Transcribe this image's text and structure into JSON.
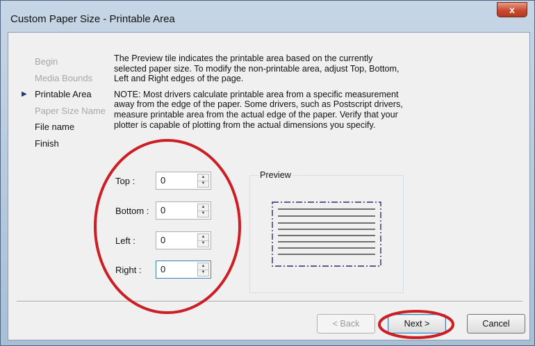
{
  "window": {
    "title": "Custom Paper Size - Printable Area",
    "close_label": "x"
  },
  "steps": [
    {
      "label": "Begin",
      "state": "done-dim"
    },
    {
      "label": "Media Bounds",
      "state": "done-dim"
    },
    {
      "label": "Printable Area",
      "state": "current"
    },
    {
      "label": "Paper Size Name",
      "state": "done-dim"
    },
    {
      "label": "File name",
      "state": "pending"
    },
    {
      "label": "Finish",
      "state": "pending"
    }
  ],
  "description": {
    "intro": "The Preview tile indicates the printable area based on the currently selected paper size. To modify the non-printable area, adjust Top, Bottom, Left and Right edges of the page.",
    "note": "NOTE: Most drivers calculate printable area from a specific measurement away from the edge of the paper. Some drivers, such as Postscript drivers, measure printable area from the actual edge of the paper. Verify that your plotter is capable of plotting from the actual dimensions you specify."
  },
  "fields": {
    "top": {
      "label": "Top :",
      "value": "0"
    },
    "bottom": {
      "label": "Bottom :",
      "value": "0"
    },
    "left": {
      "label": "Left :",
      "value": "0"
    },
    "right": {
      "label": "Right :",
      "value": "0"
    }
  },
  "preview": {
    "label": "Preview"
  },
  "buttons": {
    "back": "< Back",
    "next": "Next >",
    "cancel": "Cancel"
  },
  "colors": {
    "annotation": "#cc1f24",
    "preview_border": "#2b2b6b"
  }
}
